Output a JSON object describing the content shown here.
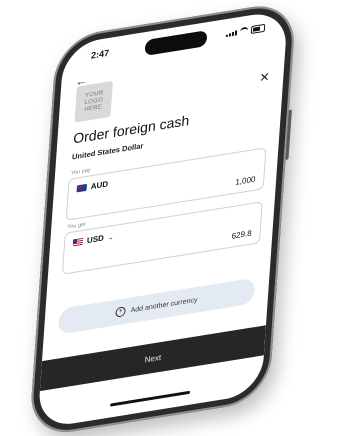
{
  "status_bar": {
    "time": "2:47"
  },
  "logo": {
    "text": "YOUR\nLOGO\nHERE"
  },
  "page": {
    "title": "Order foreign cash",
    "subtitle": "United States Dollar"
  },
  "pay_field": {
    "label": "You pay",
    "currency": "AUD",
    "amount": "1,000"
  },
  "get_field": {
    "label": "You get",
    "currency": "USD",
    "amount": "629.8"
  },
  "add_currency": {
    "label": "Add another currency"
  },
  "next_button": {
    "label": "Next"
  },
  "icons": {
    "back": "arrow-left-icon",
    "close": "close-icon",
    "add": "plus-circle-icon",
    "dropdown": "chevron-down-icon"
  }
}
